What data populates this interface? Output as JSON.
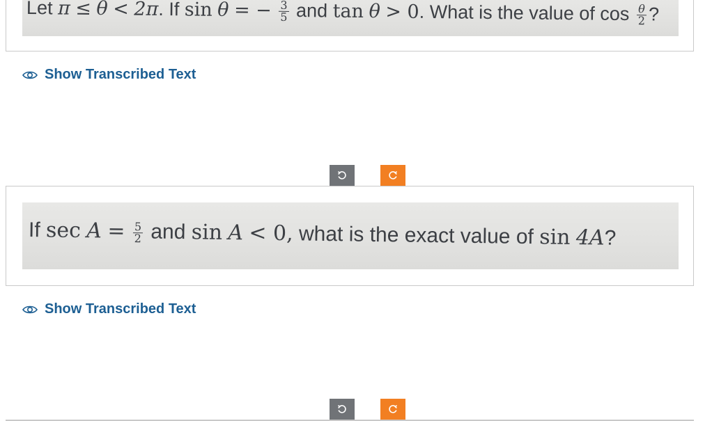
{
  "questions": [
    {
      "parts": {
        "let": "Let",
        "pi1": "π",
        "le": "≤",
        "theta1": "θ",
        "lt": "<",
        "twopi": "2π",
        "dot_if": ". If",
        "sin": "sin",
        "theta2": "θ",
        "eq": "= −",
        "frac_num": "3",
        "frac_den": "5",
        "and": "and",
        "tan": "tan",
        "theta3": "θ",
        "gt_zero": "> 0",
        "what": ". What is the value of",
        "cos": "cos",
        "half_num": "θ",
        "half_den": "2",
        "qmark": "?"
      },
      "show_transcribed_label": "Show Transcribed Text"
    },
    {
      "parts": {
        "if": "If",
        "sec": "sec",
        "A1": "A",
        "eq": "=",
        "frac_num": "5",
        "frac_den": "2",
        "and": "and",
        "sin": "sin",
        "A2": "A",
        "lt_zero": "< 0,",
        "what": "what is the exact value of",
        "sin2": "sin",
        "fourA": "4A",
        "qmark": "?"
      },
      "show_transcribed_label": "Show Transcribed Text"
    }
  ],
  "icons": {
    "eye": "eye-icon",
    "rotate_left": "rotate-left-icon",
    "rotate_right": "rotate-right-icon"
  },
  "colors": {
    "link": "#1d5f93",
    "rotate_left_bg": "#707377",
    "rotate_right_bg": "#f27f22",
    "card_border": "#c9c9c9",
    "photo_bg": "#e4e4e2",
    "photo_text": "#3c3f44"
  }
}
